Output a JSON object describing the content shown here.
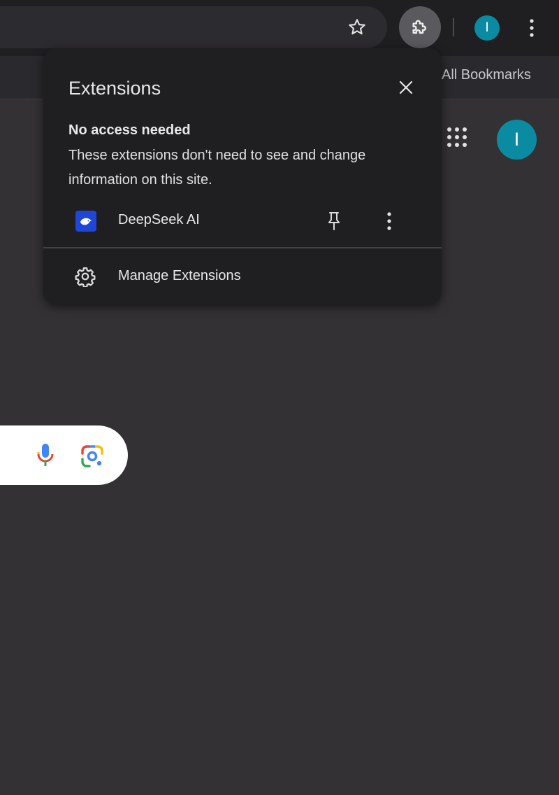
{
  "toolbar": {
    "bookmark_star_icon": "star-outline-icon",
    "extensions_icon": "puzzle-piece-icon",
    "profile_initial": "I",
    "menu_icon": "vertical-ellipsis-icon",
    "profile_color": "#0b8ba1"
  },
  "bookmarks_bar": {
    "all_bookmarks_label": "All Bookmarks"
  },
  "page": {
    "apps_icon": "apps-grid-icon",
    "avatar_initial": "I",
    "search": {
      "mic_icon": "microphone-icon",
      "lens_icon": "google-lens-icon"
    }
  },
  "extensions_popup": {
    "title": "Extensions",
    "close_icon": "close-icon",
    "section_heading": "No access needed",
    "section_description": "These extensions don't need to see and change information on this site.",
    "extensions": [
      {
        "name": "DeepSeek AI",
        "icon": "deepseek-whale-icon",
        "icon_color": "#1f46d6",
        "pin_icon": "pin-icon",
        "more_icon": "vertical-ellipsis-icon"
      }
    ],
    "manage_label": "Manage Extensions",
    "manage_icon": "gear-icon"
  },
  "colors": {
    "background": "#333134",
    "popup_background": "#1f1e21",
    "toolbar_background": "#1f1f22",
    "accent_profile": "#0b8ba1"
  }
}
